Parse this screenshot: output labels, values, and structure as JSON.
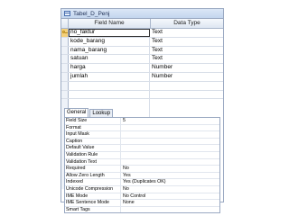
{
  "window": {
    "title": "Tabel_D_Penj"
  },
  "grid": {
    "columns": {
      "field_name": "Field Name",
      "data_type": "Data Type"
    },
    "rows": [
      {
        "field_name": "no_faktur",
        "data_type": "Text",
        "primary_key": true,
        "active": true
      },
      {
        "field_name": "kode_barang",
        "data_type": "Text"
      },
      {
        "field_name": "nama_barang",
        "data_type": "Text"
      },
      {
        "field_name": "satuan",
        "data_type": "Text"
      },
      {
        "field_name": "harga",
        "data_type": "Number"
      },
      {
        "field_name": "jumlah",
        "data_type": "Number"
      },
      {
        "field_name": "",
        "data_type": ""
      },
      {
        "field_name": "",
        "data_type": ""
      }
    ]
  },
  "properties": {
    "tabs": [
      "General",
      "Lookup"
    ],
    "active_tab": "General",
    "rows": [
      {
        "label": "Field Size",
        "value": "5"
      },
      {
        "label": "Format",
        "value": ""
      },
      {
        "label": "Input Mask",
        "value": ""
      },
      {
        "label": "Caption",
        "value": ""
      },
      {
        "label": "Default Value",
        "value": ""
      },
      {
        "label": "Validation Rule",
        "value": ""
      },
      {
        "label": "Validation Text",
        "value": ""
      },
      {
        "label": "Required",
        "value": "No"
      },
      {
        "label": "Allow Zero Length",
        "value": "Yes"
      },
      {
        "label": "Indexed",
        "value": "Yes (Duplicates OK)"
      },
      {
        "label": "Unicode Compression",
        "value": "No"
      },
      {
        "label": "IME Mode",
        "value": "No Control"
      },
      {
        "label": "IME Sentence Mode",
        "value": "None"
      },
      {
        "label": "Smart Tags",
        "value": ""
      }
    ]
  }
}
